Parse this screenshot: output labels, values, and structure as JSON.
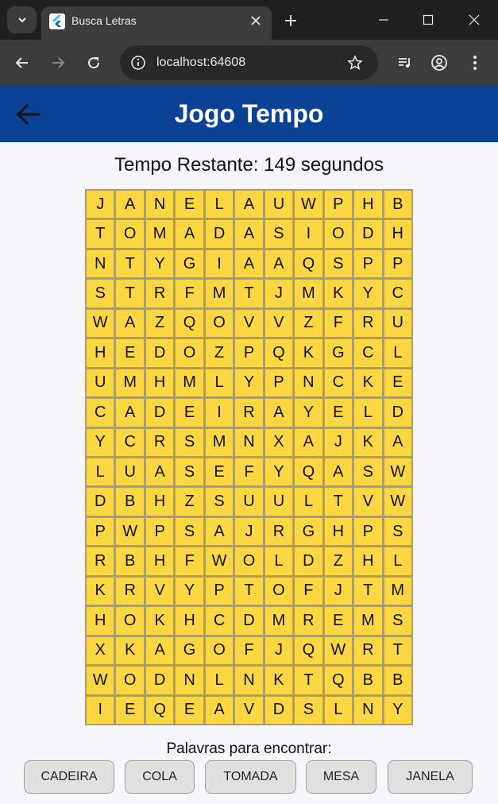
{
  "browser": {
    "tab_title": "Busca Letras",
    "url": "localhost:64608",
    "new_tab_symbol": "+",
    "icons": [
      "tab-search-icon",
      "flutter-logo-icon",
      "close-icon",
      "new-tab-icon",
      "minimize-icon",
      "maximize-icon",
      "window-close-icon",
      "back-icon",
      "forward-icon",
      "reload-icon",
      "site-info-icon",
      "bookmark-star-icon",
      "media-controls-icon",
      "profile-icon",
      "menu-icon"
    ]
  },
  "app": {
    "title": "Jogo Tempo",
    "timer_text": "Tempo Restante: 149 segundos",
    "colors": {
      "appbar": "#0a4395",
      "cell": "#fdd742",
      "background": "#f8f6fc"
    },
    "grid": [
      [
        "J",
        "A",
        "N",
        "E",
        "L",
        "A",
        "U",
        "W",
        "P",
        "H",
        "B"
      ],
      [
        "T",
        "O",
        "M",
        "A",
        "D",
        "A",
        "S",
        "I",
        "O",
        "D",
        "H"
      ],
      [
        "N",
        "T",
        "Y",
        "G",
        "I",
        "A",
        "A",
        "Q",
        "S",
        "P",
        "P"
      ],
      [
        "S",
        "T",
        "R",
        "F",
        "M",
        "T",
        "J",
        "M",
        "K",
        "Y",
        "C"
      ],
      [
        "W",
        "A",
        "Z",
        "Q",
        "O",
        "V",
        "V",
        "Z",
        "F",
        "R",
        "U"
      ],
      [
        "H",
        "E",
        "D",
        "O",
        "Z",
        "P",
        "Q",
        "K",
        "G",
        "C",
        "L"
      ],
      [
        "U",
        "M",
        "H",
        "M",
        "L",
        "Y",
        "P",
        "N",
        "C",
        "K",
        "E"
      ],
      [
        "C",
        "A",
        "D",
        "E",
        "I",
        "R",
        "A",
        "Y",
        "E",
        "L",
        "D"
      ],
      [
        "Y",
        "C",
        "R",
        "S",
        "M",
        "N",
        "X",
        "A",
        "J",
        "K",
        "A"
      ],
      [
        "L",
        "U",
        "A",
        "S",
        "E",
        "F",
        "Y",
        "Q",
        "A",
        "S",
        "W"
      ],
      [
        "D",
        "B",
        "H",
        "Z",
        "S",
        "U",
        "U",
        "L",
        "T",
        "V",
        "W"
      ],
      [
        "P",
        "W",
        "P",
        "S",
        "A",
        "J",
        "R",
        "G",
        "H",
        "P",
        "S"
      ],
      [
        "R",
        "B",
        "H",
        "F",
        "W",
        "O",
        "L",
        "D",
        "Z",
        "H",
        "L"
      ],
      [
        "K",
        "R",
        "V",
        "Y",
        "P",
        "T",
        "O",
        "F",
        "J",
        "T",
        "M"
      ],
      [
        "H",
        "O",
        "K",
        "H",
        "C",
        "D",
        "M",
        "R",
        "E",
        "M",
        "S"
      ],
      [
        "X",
        "K",
        "A",
        "G",
        "O",
        "F",
        "J",
        "Q",
        "W",
        "R",
        "T"
      ],
      [
        "W",
        "O",
        "D",
        "N",
        "L",
        "N",
        "K",
        "T",
        "Q",
        "B",
        "B"
      ],
      [
        "I",
        "E",
        "Q",
        "E",
        "A",
        "V",
        "D",
        "S",
        "L",
        "N",
        "Y"
      ]
    ],
    "words_title": "Palavras para encontrar:",
    "words": [
      "CADEIRA",
      "COLA",
      "TOMADA",
      "MESA",
      "JANELA"
    ]
  }
}
